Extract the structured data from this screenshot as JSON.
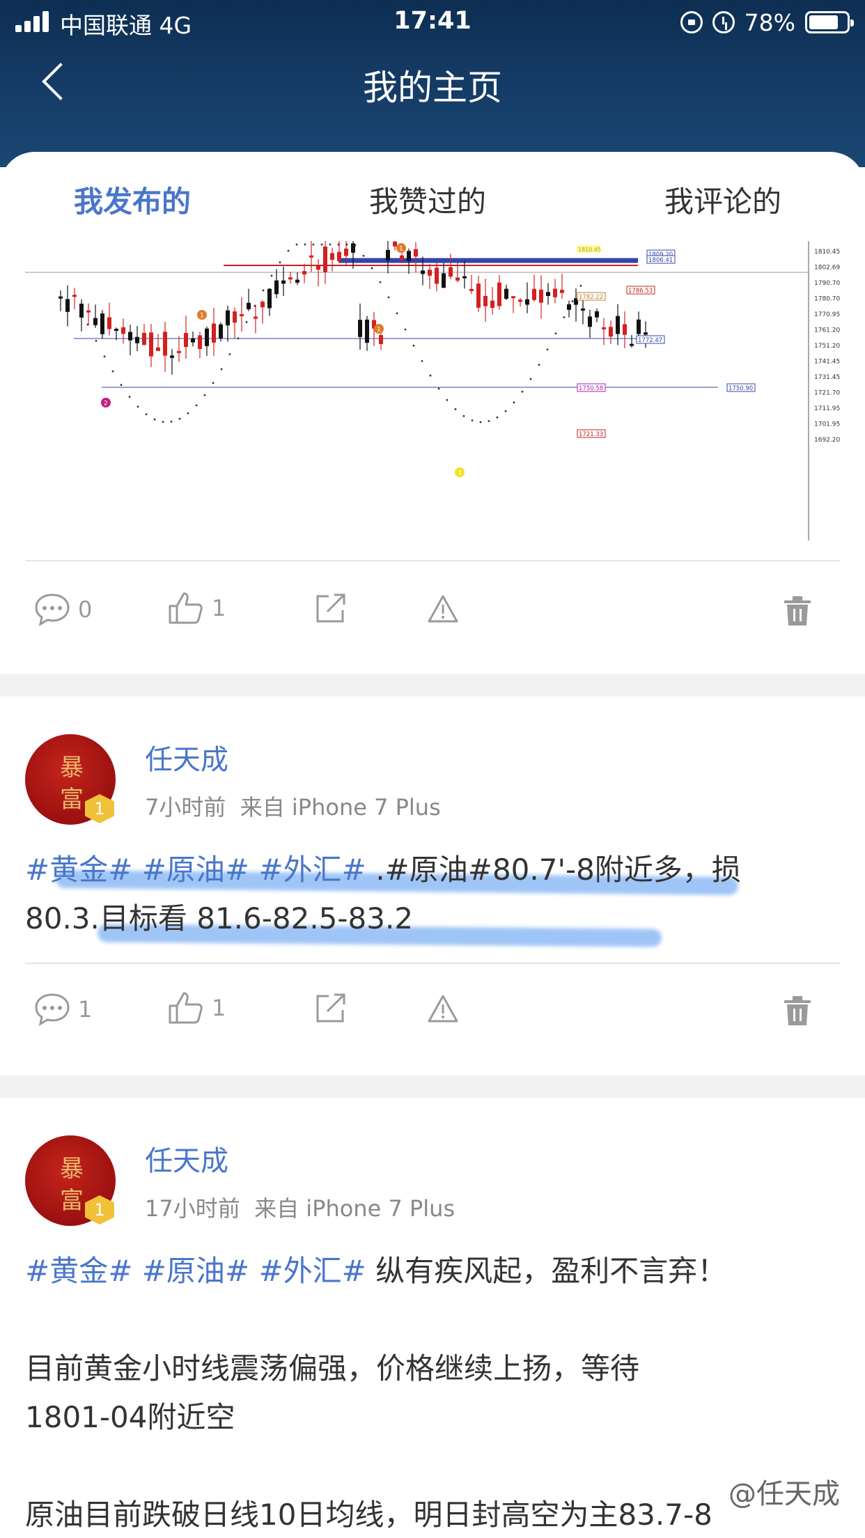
{
  "status_bar": {
    "carrier": "中国联通  4G",
    "time": "17:41",
    "battery": "78%",
    "battery_level": 0.78
  },
  "nav": {
    "title": "我的主页"
  },
  "tabs": [
    {
      "label": "我发布的",
      "active": true
    },
    {
      "label": "我赞过的",
      "active": false
    },
    {
      "label": "我评论的",
      "active": false
    }
  ],
  "chart": {
    "price_labels": [
      "1810.45",
      "1802.69",
      "1790.70",
      "1780.70",
      "1770.95",
      "1761.20",
      "1751.20",
      "1741.45",
      "1731.45",
      "1721.70",
      "1711.95",
      "1701.95",
      "1692.20"
    ],
    "level_tags": [
      "1809.20",
      "1806.41",
      "1786.53",
      "1782.22",
      "1772.47",
      "1750.58",
      "1750.90",
      "1721.33"
    ],
    "markers": [
      "1",
      "1",
      "1",
      "2",
      "3"
    ],
    "top_tag": "1810.45"
  },
  "posts": [
    {
      "comments": "0",
      "likes": "1"
    },
    {
      "author": "任天成",
      "avatar_text": [
        "暴",
        "富"
      ],
      "level": "1",
      "time": "7小时前",
      "source": "来自 iPhone 7 Plus",
      "tags": "#黄金# #原油# #外汇#",
      "text_line1_rest": " .#原油#80.7'-8附近多，损",
      "text_line2": "80.3.目标看 81.6-82.5-83.2",
      "comments": "1",
      "likes": "1"
    },
    {
      "author": "任天成",
      "avatar_text": [
        "暴",
        "富"
      ],
      "level": "1",
      "time": "17小时前",
      "source": "来自 iPhone 7 Plus",
      "tags": "#黄金# #原油# #外汇#",
      "text_line1_rest": " 纵有疾风起，盈利不言弃！",
      "para2_line1": "目前黄金小时线震荡偏强，价格继续上扬，等待",
      "para2_line2": "1801-04附近空",
      "para3_line1": "原油目前跌破日线10日均线，明日封高空为主83.7-8"
    }
  ],
  "watermark": "@任天成"
}
